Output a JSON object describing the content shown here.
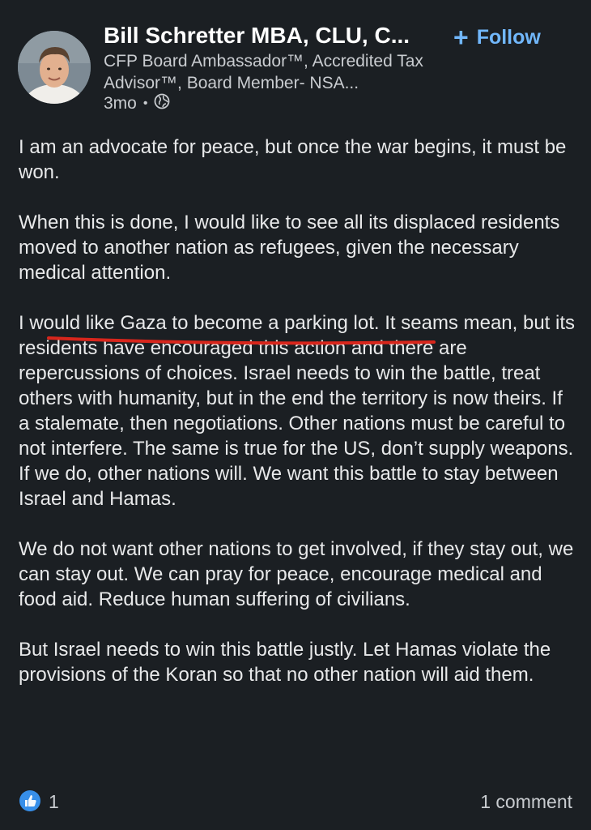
{
  "author": {
    "name": "Bill Schretter MBA, CLU, C...",
    "headline": "CFP Board Ambassador™, Accredited Tax Advisor™, Board Member- NSA...",
    "time_ago": "3mo",
    "visibility_icon": "globe-icon"
  },
  "follow": {
    "label": "Follow",
    "icon": "plus-icon",
    "color": "#71b7fb"
  },
  "post": {
    "paragraphs": [
      "I am an advocate for peace, but once the war begins, it must be won.",
      "When this is done, I would like to see all its displaced residents moved to another nation as refugees, given the necessary medical attention.",
      "I would like Gaza to become a parking lot.  It seams mean, but its residents have encouraged this action and there are repercussions of choices. Israel needs to win the battle, treat others with humanity, but in the end the territory is now theirs. If a stalemate, then negotiations. Other nations must be careful to not interfere. The same is true for the US, don’t supply weapons. If we do, other nations will. We want this battle to stay between Israel and Hamas.",
      "We do not want other nations to get involved, if they stay out, we can stay out. We can pray for peace, encourage medical and food aid. Reduce human suffering of civilians.",
      "But Israel needs to win this battle justly. Let Hamas violate the provisions of the Koran so that no other nation will aid them."
    ],
    "annotation_color": "#d8261c"
  },
  "engagement": {
    "reaction_icon": "like-icon",
    "reaction_count": "1",
    "comments": "1 comment"
  }
}
